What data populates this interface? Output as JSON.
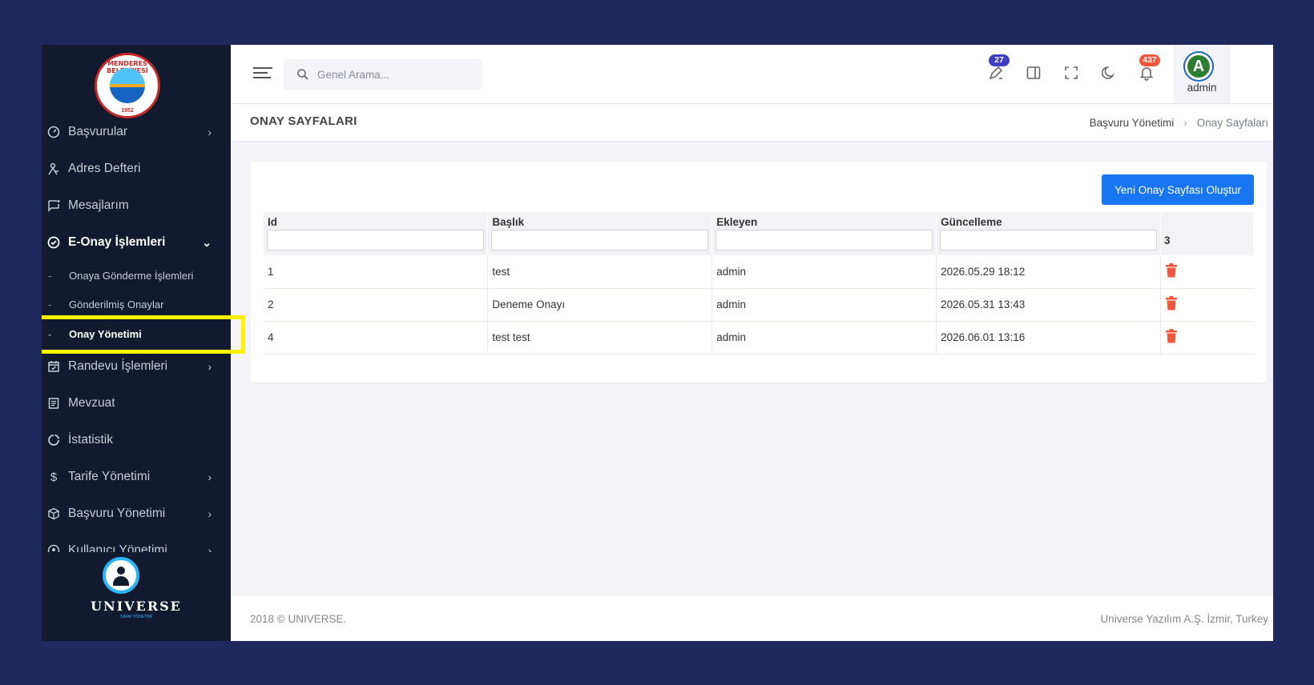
{
  "sidebar": {
    "logo": {
      "ring_text": "MENDERES BELEDİYESİ",
      "year": "1952"
    },
    "items": [
      {
        "label": "Başvurular",
        "icon": "gauge-icon",
        "has_chevron": true
      },
      {
        "label": "Adres Defteri",
        "icon": "person-pin-icon",
        "has_chevron": false
      },
      {
        "label": "Mesajlarım",
        "icon": "message-icon",
        "has_chevron": false
      },
      {
        "label": "E-Onay İşlemleri",
        "icon": "check-circle-icon",
        "has_chevron": true,
        "expanded": true
      },
      {
        "label": "Randevu İşlemleri",
        "icon": "calendar-check-icon",
        "has_chevron": true
      },
      {
        "label": "Mevzuat",
        "icon": "document-icon",
        "has_chevron": false
      },
      {
        "label": "İstatistik",
        "icon": "pie-chart-icon",
        "has_chevron": false
      },
      {
        "label": "Tarife Yönetimi",
        "icon": "dollar-icon",
        "has_chevron": true
      },
      {
        "label": "Başvuru Yönetimi",
        "icon": "box-icon",
        "has_chevron": true
      },
      {
        "label": "Kullanıcı Yönetimi",
        "icon": "user-cog-icon",
        "has_chevron": true
      }
    ],
    "subitems": [
      {
        "label": "Onaya Gönderme İşlemleri"
      },
      {
        "label": "Gönderilmiş Onaylar"
      },
      {
        "label": "Onay Yönetimi",
        "current": true
      }
    ],
    "brand": {
      "name": "UNIVERSE",
      "tagline": "SIRAV YÖNETİMİ"
    }
  },
  "topbar": {
    "search_placeholder": "Genel Arama...",
    "sign_badge": "27",
    "notif_badge": "437",
    "user": {
      "initial": "A",
      "name": "admin"
    },
    "colors": {
      "sign_badge": "#3f3ec4",
      "notif_badge": "#f0573d"
    }
  },
  "page": {
    "title": "ONAY SAYFALARI",
    "breadcrumb": [
      "Başvuru Yönetimi",
      "Onay Sayfaları"
    ],
    "new_button": "Yeni Onay Sayfası Oluştur"
  },
  "table": {
    "columns": [
      "Id",
      "Başlık",
      "Ekleyen",
      "Güncelleme"
    ],
    "count": "3",
    "rows": [
      {
        "id": "1",
        "title": "test",
        "author": "admin",
        "updated": "2026.05.29 18:12"
      },
      {
        "id": "2",
        "title": "Deneme Onayı",
        "author": "admin",
        "updated": "2026.05.31 13:43"
      },
      {
        "id": "4",
        "title": "test test",
        "author": "admin",
        "updated": "2026.06.01 13:16"
      }
    ]
  },
  "footer": {
    "left": "2018 © UNIVERSE.",
    "right": "Universe Yazılım A.Ş. İzmir, Turkey"
  },
  "colors": {
    "primary": "#1976f2",
    "sidebar": "#111a2e",
    "highlight": "#fff200",
    "danger": "#f0573d"
  }
}
